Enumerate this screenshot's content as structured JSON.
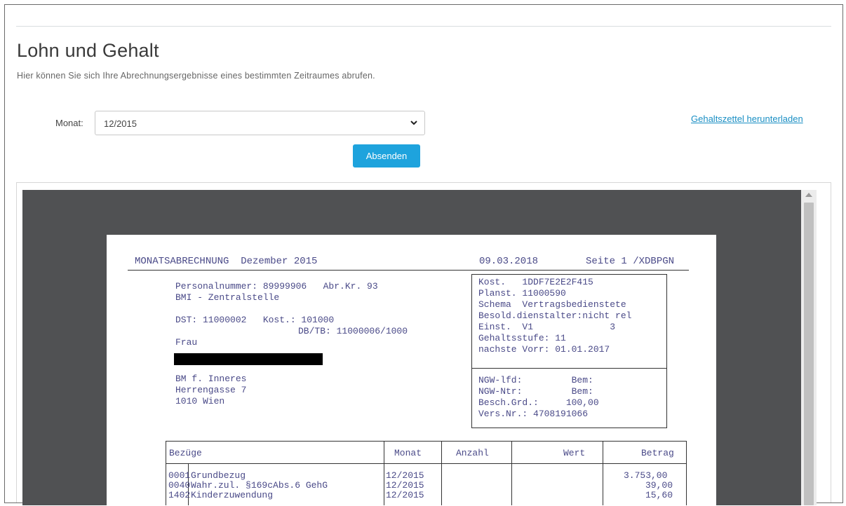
{
  "page": {
    "title": "Lohn und Gehalt",
    "subtitle": "Hier können Sie sich Ihre Abrechnungsergebnisse eines bestimmten Zeitraumes abrufen."
  },
  "form": {
    "month_label": "Monat:",
    "month_value": "12/2015",
    "submit_label": "Absenden",
    "download_link": "Gehaltszettel herunterladen"
  },
  "document": {
    "header": {
      "title": "MONATSABRECHNUNG  Dezember 2015",
      "date": "09.03.2018",
      "page": "Seite 1 /XDBPGN"
    },
    "personal": {
      "personalnummer": "Personalnummer: 89999906   Abr.Kr. 93",
      "dienststelle": "BMI - Zentralstelle",
      "dst": "DST: 11000002   Kost.: 101000",
      "dbtb": "DB/TB: 11000006/1000",
      "anrede": "Frau"
    },
    "address": [
      "BM f. Inneres",
      "Herrengasse 7",
      "1010 Wien"
    ],
    "info_box_1": [
      "Kost.   1DDF7E2E2F415",
      "Planst. 11000590",
      "Schema  Vertragsbedienstete",
      "Besold.dienstalter:nicht rel",
      "Einst.  V1              3",
      "Gehaltsstufe: 11",
      "nachste Vorr: 01.01.2017"
    ],
    "info_box_2": [
      "NGW-lfd:         Bem:",
      "NGW-Ntr:         Bem:",
      "Besch.Grd.:     100,00",
      "Vers.Nr.: 4708191066"
    ],
    "table": {
      "headers": [
        "Bezüge",
        "Monat",
        "Anzahl",
        "Wert",
        "Betrag"
      ],
      "rows": [
        {
          "code": "0001",
          "text": "Grundbezug",
          "monat": "12/2015",
          "betrag": "3.753,00"
        },
        {
          "code": "0040",
          "text": "Wahr.zul. §169cAbs.6 GehG",
          "monat": "12/2015",
          "betrag": "39,00"
        },
        {
          "code": "1402",
          "text": "Kinderzuwendung",
          "monat": "12/2015",
          "betrag": "15,60"
        }
      ]
    }
  }
}
